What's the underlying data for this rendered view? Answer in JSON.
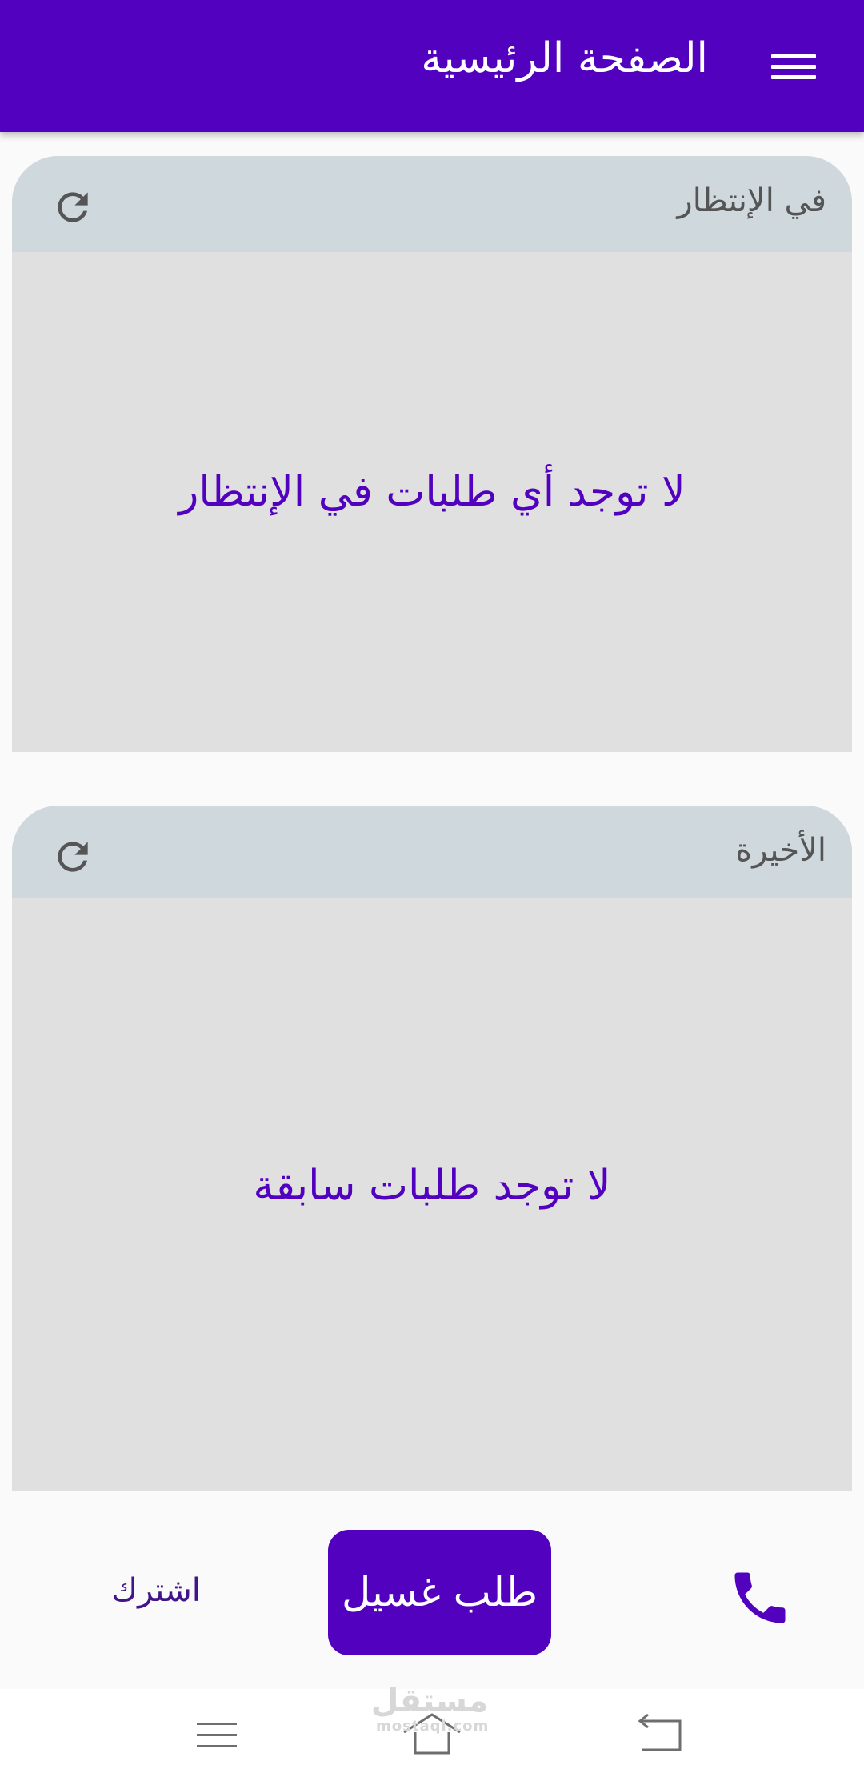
{
  "appbar": {
    "title": "الصفحة الرئيسية",
    "menu_icon": "hamburger-menu-icon",
    "background": "#5201bf"
  },
  "cards": {
    "pending": {
      "title": "في الإنتظار",
      "empty_message": "لا توجد أي طلبات في الإنتظار",
      "refresh_icon": "refresh-icon"
    },
    "recent": {
      "title": "الأخيرة",
      "empty_message": "لا توجد طلبات سابقة",
      "refresh_icon": "refresh-icon"
    }
  },
  "bottom_bar": {
    "subscribe_label": "اشترك",
    "wash_request_label": "طلب غسيل",
    "phone_icon": "phone-icon"
  },
  "system_nav": {
    "recents_icon": "recents-icon",
    "home_icon": "home-icon",
    "back_icon": "back-icon"
  },
  "watermark": {
    "text": "مستقل",
    "subtext": "mostaql.com"
  },
  "colors": {
    "primary": "#5201bf",
    "card_header": "#cfd8dd",
    "card_body": "#e0e0e0",
    "subscribe_text": "#41148a"
  }
}
